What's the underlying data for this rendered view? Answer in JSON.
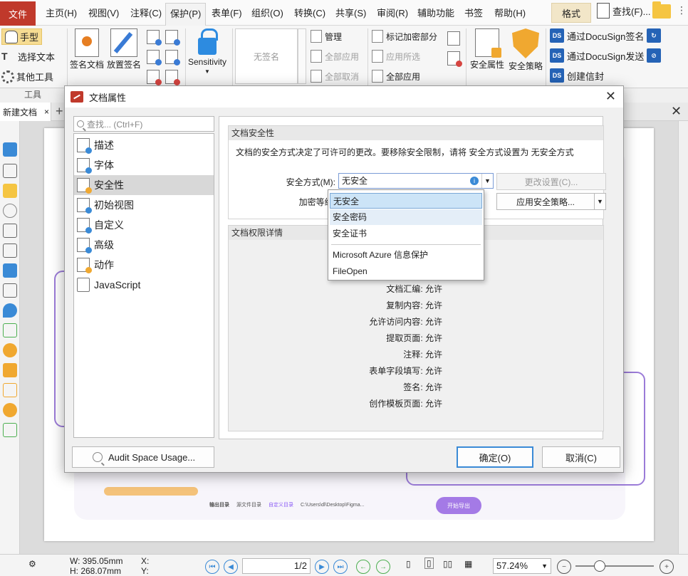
{
  "menubar": {
    "file": "文件",
    "items": [
      "主页(H)",
      "视图(V)",
      "注释(C)",
      "保护(P)",
      "表单(F)",
      "组织(O)",
      "转换(C)",
      "共享(S)",
      "审阅(R)",
      "辅助功能",
      "书签",
      "帮助(H)"
    ],
    "active_index": 3,
    "format_tab": "格式",
    "search": "查找(F)..."
  },
  "ribbon": {
    "hand": "手型",
    "select_text": "选择文本",
    "other_tools": "其他工具",
    "tools_group": "工具",
    "sign_doc": "签名文档",
    "place_sig": "放置签名",
    "sensitivity": "Sensitivity",
    "no_signature": "无签名",
    "manage": "管理",
    "apply_all": "全部应用",
    "cancel_all": "全部取消",
    "mark_redact": "标记加密部分",
    "apply_selected": "应用所选",
    "apply_all_redact": "全部应用",
    "sec_props": "安全属性",
    "sec_policy": "安全策略",
    "docusign_sign": "通过DocuSign签名",
    "docusign_send": "通过DocuSign发送",
    "create_envelope": "创建信封"
  },
  "tabs": {
    "doc_tab": "新建文档"
  },
  "document": {
    "output_dir": "输出目录",
    "src_dir": "源文件目录",
    "custom_dir": "自定义目录",
    "path": "C:\\Users\\dl\\Desktop\\Figma...",
    "export_btn": "开始导出"
  },
  "statusbar": {
    "width": "W: 395.05mm",
    "height": "H: 268.07mm",
    "x": "X:",
    "y": "Y:",
    "page_current": "1",
    "page_total": "2",
    "zoom": "57.24%"
  },
  "dialog": {
    "title": "文档属性",
    "search_placeholder": "查找... (Ctrl+F)",
    "nav": [
      "描述",
      "字体",
      "安全性",
      "初始视图",
      "自定义",
      "高级",
      "动作",
      "JavaScript"
    ],
    "selected_nav": 2,
    "security": {
      "section_title": "文档安全性",
      "description": "文档的安全方式决定了可许可的更改。要移除安全限制，请将 安全方式设置为 无安全方式",
      "method_label": "安全方式(M):",
      "method_value": "无安全",
      "encryption_label": "加密等级:",
      "change_settings": "更改设置(C)...",
      "apply_policy": "应用安全策略...",
      "dropdown_options": [
        "无安全",
        "安全密码",
        "安全证书",
        "Microsoft Azure 信息保护",
        "FileOpen"
      ],
      "permissions_title": "文档权限详情",
      "permissions": [
        {
          "label": "文档汇编",
          "value": "允许"
        },
        {
          "label": "复制内容",
          "value": "允许"
        },
        {
          "label": "允许访问内容",
          "value": "允许"
        },
        {
          "label": "提取页面",
          "value": "允许"
        },
        {
          "label": "注释",
          "value": "允许"
        },
        {
          "label": "表单字段填写",
          "value": "允许"
        },
        {
          "label": "签名",
          "value": "允许"
        },
        {
          "label": "创作模板页面",
          "value": "允许"
        }
      ]
    },
    "audit_btn": "Audit Space Usage...",
    "ok_btn": "确定(O)",
    "cancel_btn": "取消(C)"
  },
  "colors": {
    "file_menu": "#c0392b",
    "accent": "#3a8ad6",
    "hand_highlight": "#f6dc92",
    "page_accent": "#a47ae6"
  }
}
